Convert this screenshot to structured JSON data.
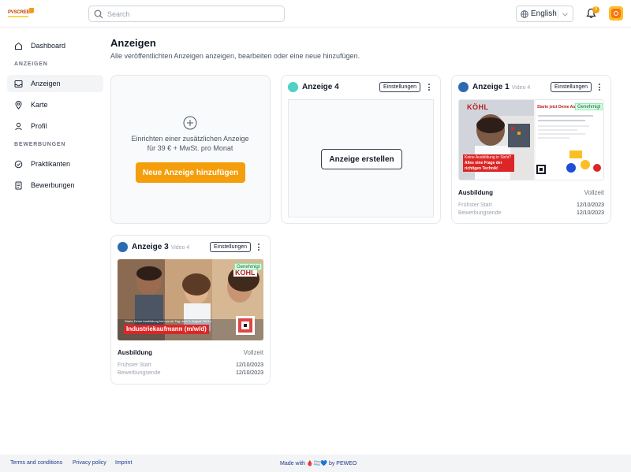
{
  "header": {
    "logo_text": "PVSCREEN",
    "search_placeholder": "Search",
    "language": "English",
    "notification_count": "0"
  },
  "sidebar": {
    "dashboard": "Dashboard",
    "section_ads": "ANZEIGEN",
    "ads": "Anzeigen",
    "map": "Karte",
    "profile": "Profil",
    "section_applications": "BEWERBUNGEN",
    "interns": "Praktikanten",
    "applications": "Bewerbungen"
  },
  "main": {
    "title": "Anzeigen",
    "subtitle": "Alle veröffentlichten Anzeigen anzeigen, bearbeiten oder eine neue hinzufügen.",
    "add_card": {
      "text": "Einrichten einer zusätzlichen Anzeige für 39 € + MwSt. pro Monat",
      "button": "Neue Anzeige hinzufügen"
    },
    "cards": [
      {
        "title": "Anzeige 4",
        "video": "",
        "settings": "Einstellungen",
        "create_button": "Anzeige erstellen",
        "dot_color": "#4fd1c5"
      },
      {
        "title": "Anzeige 1",
        "video": "Video 4",
        "settings": "Einstellungen",
        "status": "Genehmigt",
        "thumb_brand": "KÖHL",
        "thumb_headline": "Starte jetzt Deine Ausbi",
        "thumb_banner": "Keine Ausbildung in Sicht?",
        "thumb_banner2": "Alles eine Frage der",
        "thumb_banner3": "richtigen Technik!",
        "training": "Ausbildung",
        "employment": "Vollzeit",
        "start_label": "Frühster Start",
        "start_date": "12/10/2023",
        "end_label": "Bewerbungsende",
        "end_date": "12/10/2023",
        "dot_color": "#2b6cb0"
      },
      {
        "title": "Anzeige 3",
        "video": "Video 4",
        "settings": "Einstellungen",
        "status": "Genehmigt",
        "thumb_brand": "KÖHL",
        "thumb_caption": "Starte Deine Ausbildung bei uns ab Tag: zum 1. August 2024 als",
        "thumb_banner": "Industriekaufmann (m/w/d)",
        "training": "Ausbildung",
        "employment": "Vollzeit",
        "start_label": "Frühster Start",
        "start_date": "12/10/2023",
        "end_label": "Bewerbungsende",
        "end_date": "12/10/2023",
        "dot_color": "#2b6cb0"
      }
    ]
  },
  "footer": {
    "terms": "Terms and conditions",
    "privacy": "Privacy policy",
    "imprint": "Imprint",
    "made_with": "Made with 🩸🏳️‍⚧️💙 by PEWEO"
  }
}
